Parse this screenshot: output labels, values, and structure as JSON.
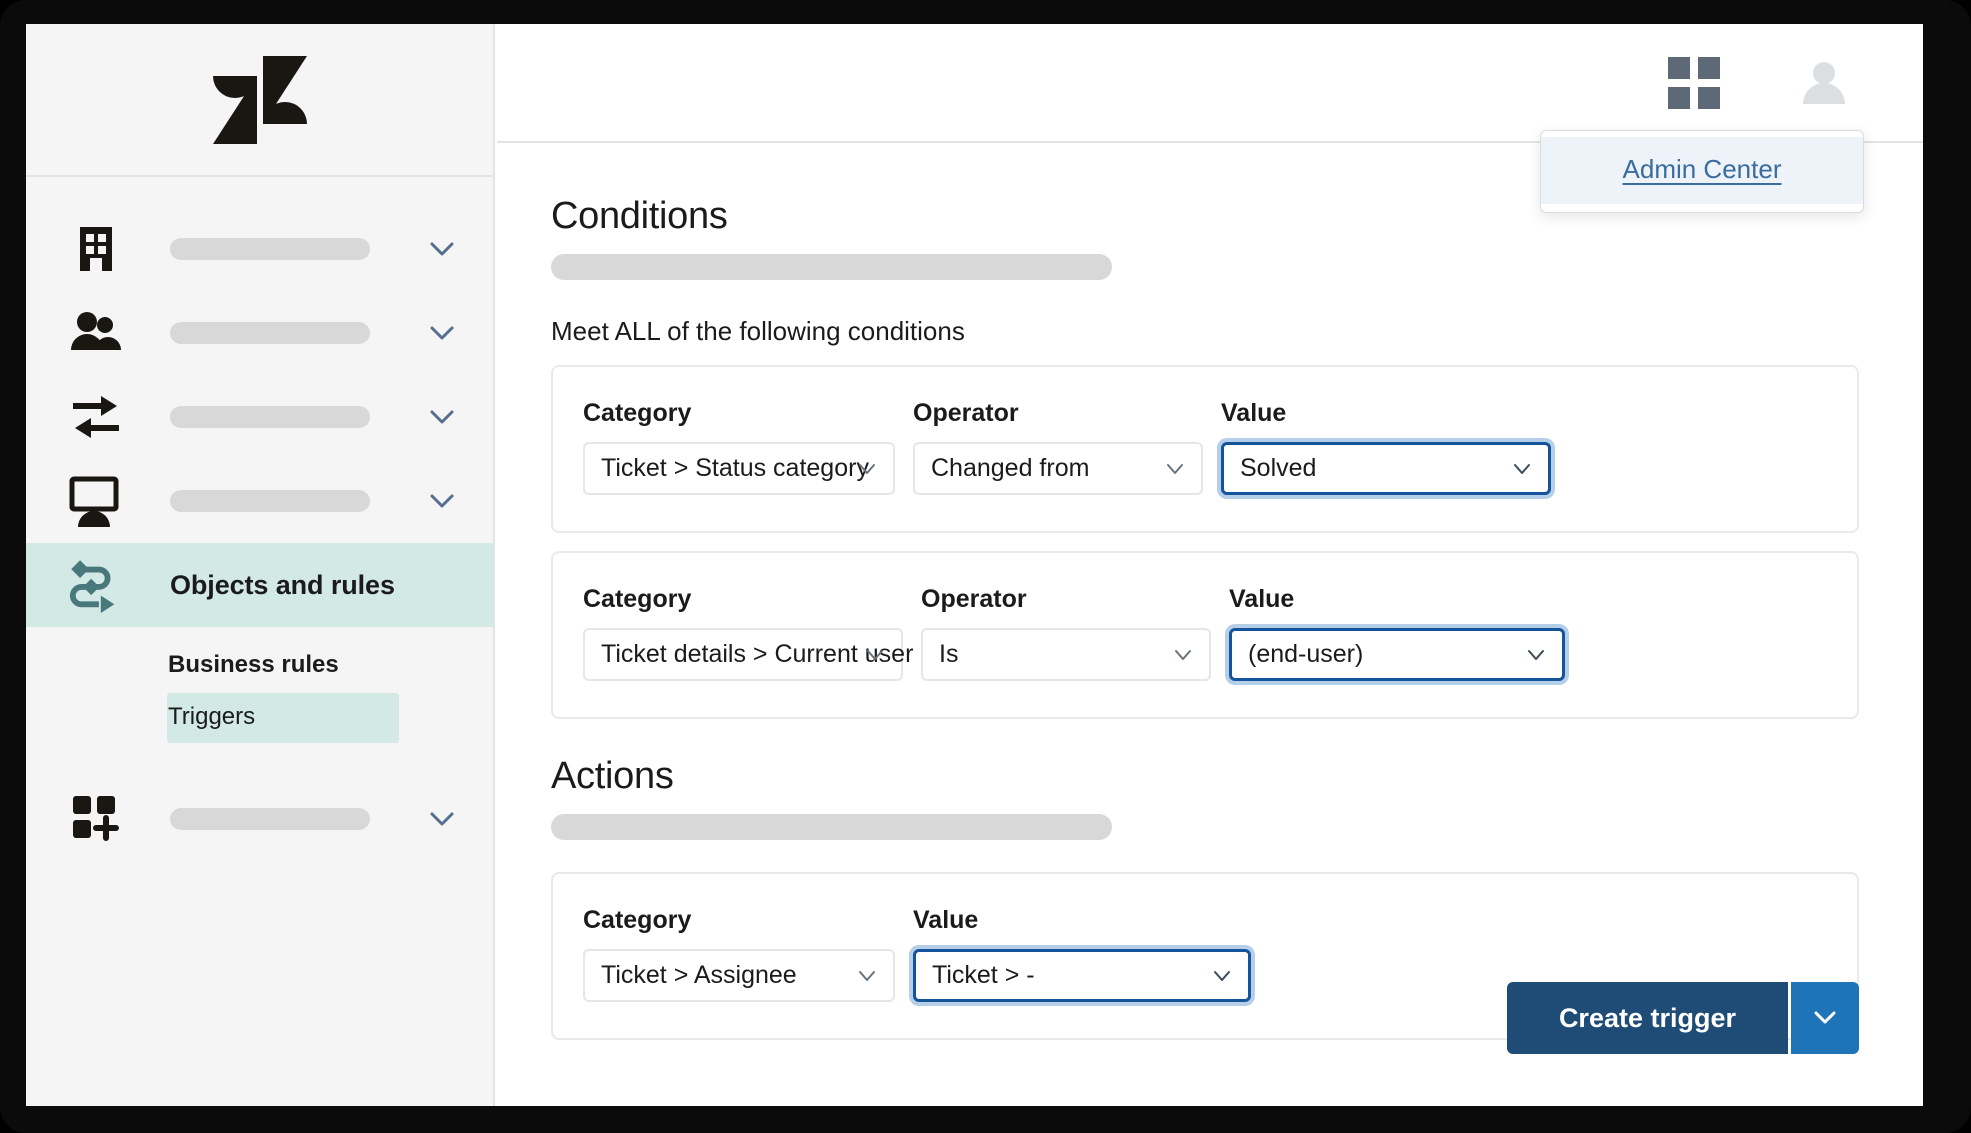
{
  "sidebar": {
    "logo": "zendesk-logo",
    "items": [
      {
        "icon": "building-icon",
        "label": "",
        "chevron": "chevron-down-icon"
      },
      {
        "icon": "people-icon",
        "label": "",
        "chevron": "chevron-down-icon"
      },
      {
        "icon": "arrows-exchange-icon",
        "label": "",
        "chevron": "chevron-down-icon"
      },
      {
        "icon": "monitor-person-icon",
        "label": "",
        "chevron": "chevron-down-icon"
      }
    ],
    "active_item": {
      "icon": "objects-rules-icon",
      "label": "Objects and rules"
    },
    "sub_heading": "Business rules",
    "sub_item": "Triggers",
    "apps_item": {
      "icon": "apps-add-icon",
      "label": "",
      "chevron": "chevron-down-icon"
    }
  },
  "topbar": {
    "products_icon": "grid-icon",
    "avatar_icon": "user-avatar-icon",
    "admin_menu": {
      "link_label": "Admin Center"
    }
  },
  "conditions": {
    "heading": "Conditions",
    "subtitle_placeholder": "",
    "meet_all_label": "Meet ALL of the following conditions",
    "labels": {
      "category": "Category",
      "operator": "Operator",
      "value": "Value"
    },
    "rows": [
      {
        "category": "Ticket > Status category",
        "operator": "Changed from",
        "value": "Solved",
        "value_focused": true
      },
      {
        "category": "Ticket details > Current user",
        "operator": "Is",
        "value": "(end-user)",
        "value_focused": true
      }
    ]
  },
  "actions": {
    "heading": "Actions",
    "subtitle_placeholder": "",
    "labels": {
      "category": "Category",
      "value": "Value"
    },
    "rows": [
      {
        "category": "Ticket > Assignee",
        "value": "Ticket > -",
        "value_focused": true
      }
    ]
  },
  "footer": {
    "primary_button": "Create trigger",
    "caret_icon": "chevron-down-icon"
  },
  "colors": {
    "sidebar_bg": "#f5f5f5",
    "active_nav_bg": "#d3e9e6",
    "accent_teal": "#49787c",
    "primary_button": "#1f4c76",
    "caret_button": "#1f73b7",
    "focus_border": "#15539b",
    "focus_ring": "#b5cfe9",
    "link_blue": "#3a6c9e",
    "placeholder_gray": "#d8d8d8"
  }
}
